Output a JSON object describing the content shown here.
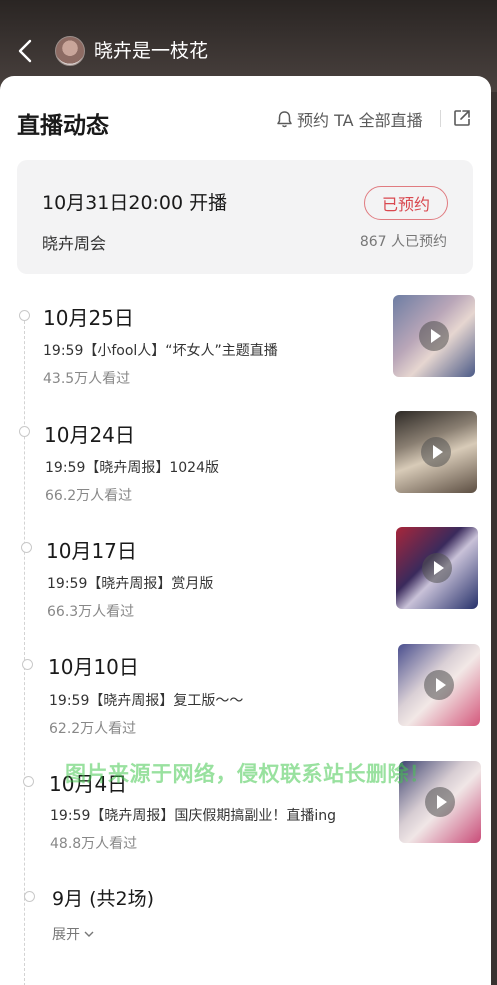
{
  "header": {
    "username": "晓卉是一枝花"
  },
  "section": {
    "title": "直播动态",
    "reserve_all": "预约 TA 全部直播"
  },
  "upcoming": {
    "time": "10月31日20:00 开播",
    "name": "晓卉周会",
    "button": "已预约",
    "count": "867 人已预约"
  },
  "items": [
    {
      "date": "10月25日",
      "title": "19:59【小fool人】“坏女人”主题直播",
      "views": "43.5万人看过"
    },
    {
      "date": "10月24日",
      "title": "19:59【晓卉周报】1024版",
      "views": "66.2万人看过"
    },
    {
      "date": "10月17日",
      "title": "19:59【晓卉周报】赏月版",
      "views": "66.3万人看过"
    },
    {
      "date": "10月10日",
      "title": "19:59【晓卉周报】复工版～～",
      "views": "62.2万人看过"
    },
    {
      "date": "10月4日",
      "title": "19:59【晓卉周报】国庆假期搞副业！直播ing",
      "views": "48.8万人看过"
    }
  ],
  "month_group": {
    "label": "9月 (共2场)",
    "expand": "展开"
  },
  "watermark": "图片来源于网络，侵权联系站长删除！",
  "icons": {
    "back": "back-arrow-icon",
    "bell": "bell-icon",
    "share": "share-external-icon",
    "play": "play-icon",
    "chevron": "chevron-down-icon"
  },
  "colors": {
    "accent": "#d9484f",
    "card_bg": "#f3f3f4"
  }
}
